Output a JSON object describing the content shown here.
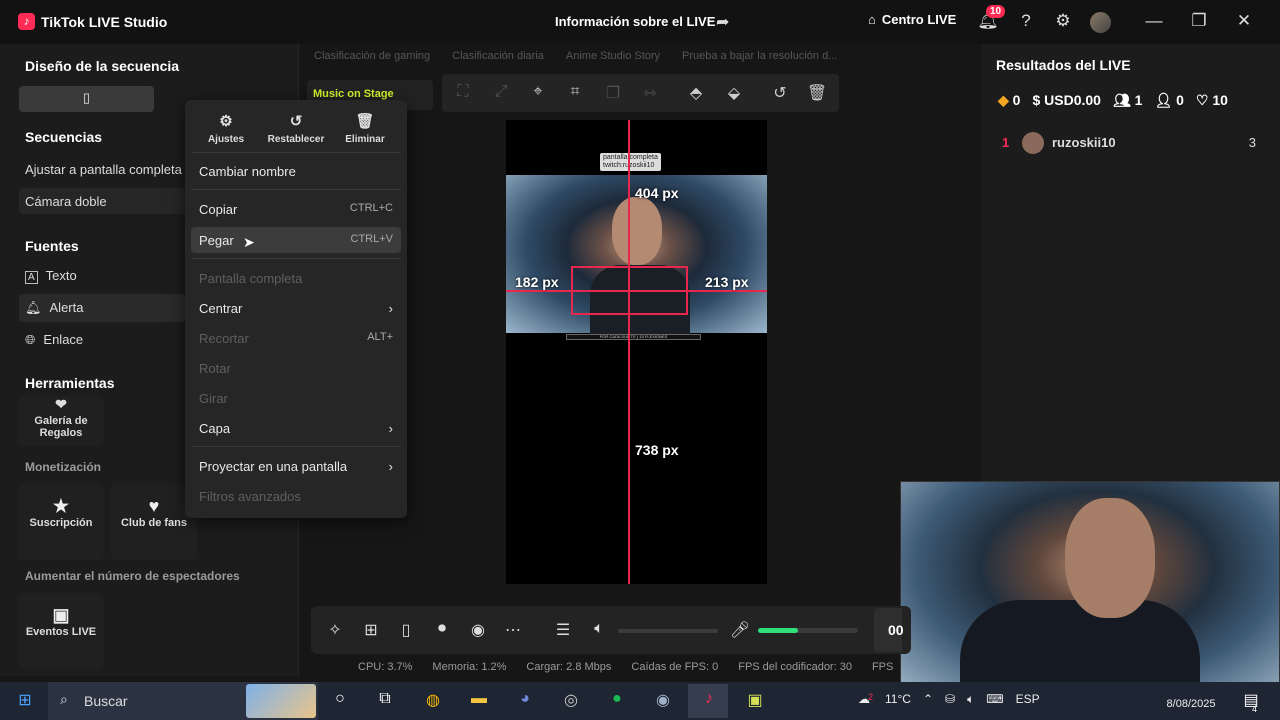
{
  "titlebar": {
    "app_title": "TikTok LIVE Studio",
    "live_info": "Información sobre el LIVE",
    "centro_live": "Centro LIVE",
    "notif_count": "10"
  },
  "left": {
    "layout_title": "Diseño de la secuencia",
    "sequences_title": "Secuencias",
    "seq_items": [
      "Ajustar a pantalla completa",
      "Cámara doble"
    ],
    "sources_title": "Fuentes",
    "source_items": [
      "Texto",
      "Alerta",
      "Enlace"
    ],
    "tools_title": "Herramientas",
    "gift_gallery": "Galería de Regalos",
    "monetization_title": "Monetización",
    "subscription": "Suscripción",
    "fan_club": "Club de fans",
    "boost_title": "Aumentar el número de espectadores",
    "live_events": "Eventos LIVE"
  },
  "center": {
    "scene_tabs": [
      "Clasificación de gaming",
      "Clasificación diaria",
      "Anime Studio Story",
      "Prueba a bajar la resolución d..."
    ],
    "music_chip": "Music on Stage",
    "overlay_label_1": "pantalla completa",
    "overlay_label_2": "twitch:ruzoskii10",
    "bottom_strip_text": "POR CADA SUB TE ( 10 FLEXIONES",
    "measure_top": "404 px",
    "measure_left": "182 px",
    "measure_right": "213 px",
    "measure_bottom": "738 px"
  },
  "context_menu": {
    "top_actions": [
      "Ajustes",
      "Restablecer",
      "Eliminar"
    ],
    "rename": "Cambiar nombre",
    "copy": "Copiar",
    "copy_sc": "CTRL+C",
    "paste": "Pegar",
    "paste_sc": "CTRL+V",
    "fullscreen": "Pantalla completa",
    "center": "Centrar",
    "crop": "Recortar",
    "crop_sc": "ALT+",
    "rotate": "Rotar",
    "flip": "Girar",
    "layer": "Capa",
    "project": "Proyectar en una pantalla",
    "advanced_filters": "Filtros avanzados"
  },
  "right": {
    "title": "Resultados del LIVE",
    "diamonds": "0",
    "usd": "USD0.00",
    "viewers": "1",
    "new_followers": "0",
    "likes": "10",
    "rank": "1",
    "user": "ruzoskii10",
    "user_value": "3"
  },
  "controls": {
    "time_partial": "00",
    "mic_level": 0.4
  },
  "status": {
    "cpu": "CPU: 3.7%",
    "memory": "Memoria: 1.2%",
    "upload": "Cargar: 2.8 Mbps",
    "fps_drops": "Caídas de FPS: 0",
    "encoder_fps": "FPS del codificador: 30",
    "fps": "FPS"
  },
  "taskbar": {
    "search_placeholder": "Buscar",
    "temp": "11°C",
    "weather_badge": "2",
    "lang": "ESP",
    "date": "8/08/2025",
    "notif": "4"
  },
  "colors": {
    "accent": "#fe2c55",
    "guide": "#e8274f",
    "mic_fill": "#2fe07a",
    "music_text": "#d6f22b"
  }
}
